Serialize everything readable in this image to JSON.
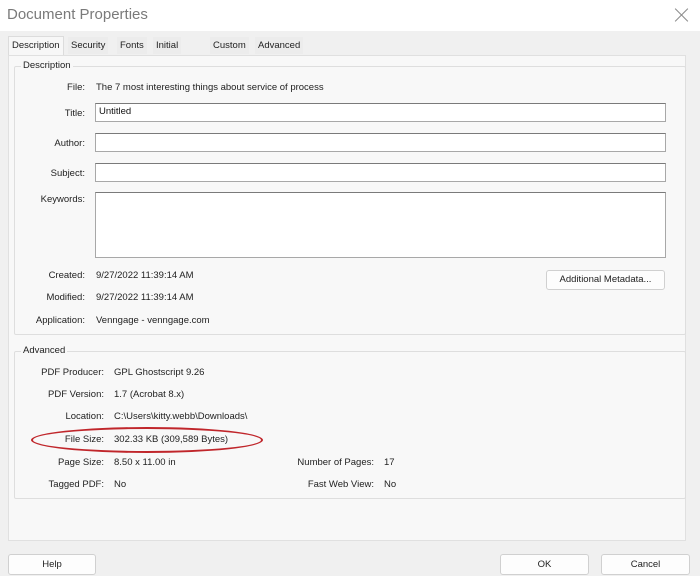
{
  "window": {
    "title": "Document Properties",
    "close_icon": "close-icon"
  },
  "tabs": [
    {
      "label": "Description",
      "active": true
    },
    {
      "label": "Security",
      "active": false
    },
    {
      "label": "Fonts",
      "active": false
    },
    {
      "label": "Initial View",
      "active": false
    },
    {
      "label": "Custom",
      "active": false
    },
    {
      "label": "Advanced",
      "active": false
    }
  ],
  "description": {
    "group_label": "Description",
    "file_label": "File:",
    "file_value": "The 7 most interesting things about service of process",
    "title_label": "Title:",
    "title_value": "Untitled",
    "author_label": "Author:",
    "author_value": "",
    "subject_label": "Subject:",
    "subject_value": "",
    "keywords_label": "Keywords:",
    "keywords_value": "",
    "created_label": "Created:",
    "created_value": "9/27/2022 11:39:14 AM",
    "modified_label": "Modified:",
    "modified_value": "9/27/2022 11:39:14 AM",
    "application_label": "Application:",
    "application_value": "Venngage - venngage.com",
    "additional_metadata_label": "Additional Metadata..."
  },
  "advanced": {
    "group_label": "Advanced",
    "producer_label": "PDF Producer:",
    "producer_value": "GPL Ghostscript 9.26",
    "version_label": "PDF Version:",
    "version_value": "1.7 (Acrobat 8.x)",
    "location_label": "Location:",
    "location_value": "C:\\Users\\kitty.webb\\Downloads\\",
    "filesize_label": "File Size:",
    "filesize_value": "302.33 KB (309,589 Bytes)",
    "pagesize_label": "Page Size:",
    "pagesize_value": "8.50 x 11.00 in",
    "pages_label": "Number of Pages:",
    "pages_value": "17",
    "tagged_label": "Tagged PDF:",
    "tagged_value": "No",
    "fastweb_label": "Fast Web View:",
    "fastweb_value": "No"
  },
  "annotation": {
    "highlight_color": "#c0262b",
    "highlighted_field": "File Size"
  },
  "footer": {
    "help_label": "Help",
    "ok_label": "OK",
    "cancel_label": "Cancel"
  }
}
